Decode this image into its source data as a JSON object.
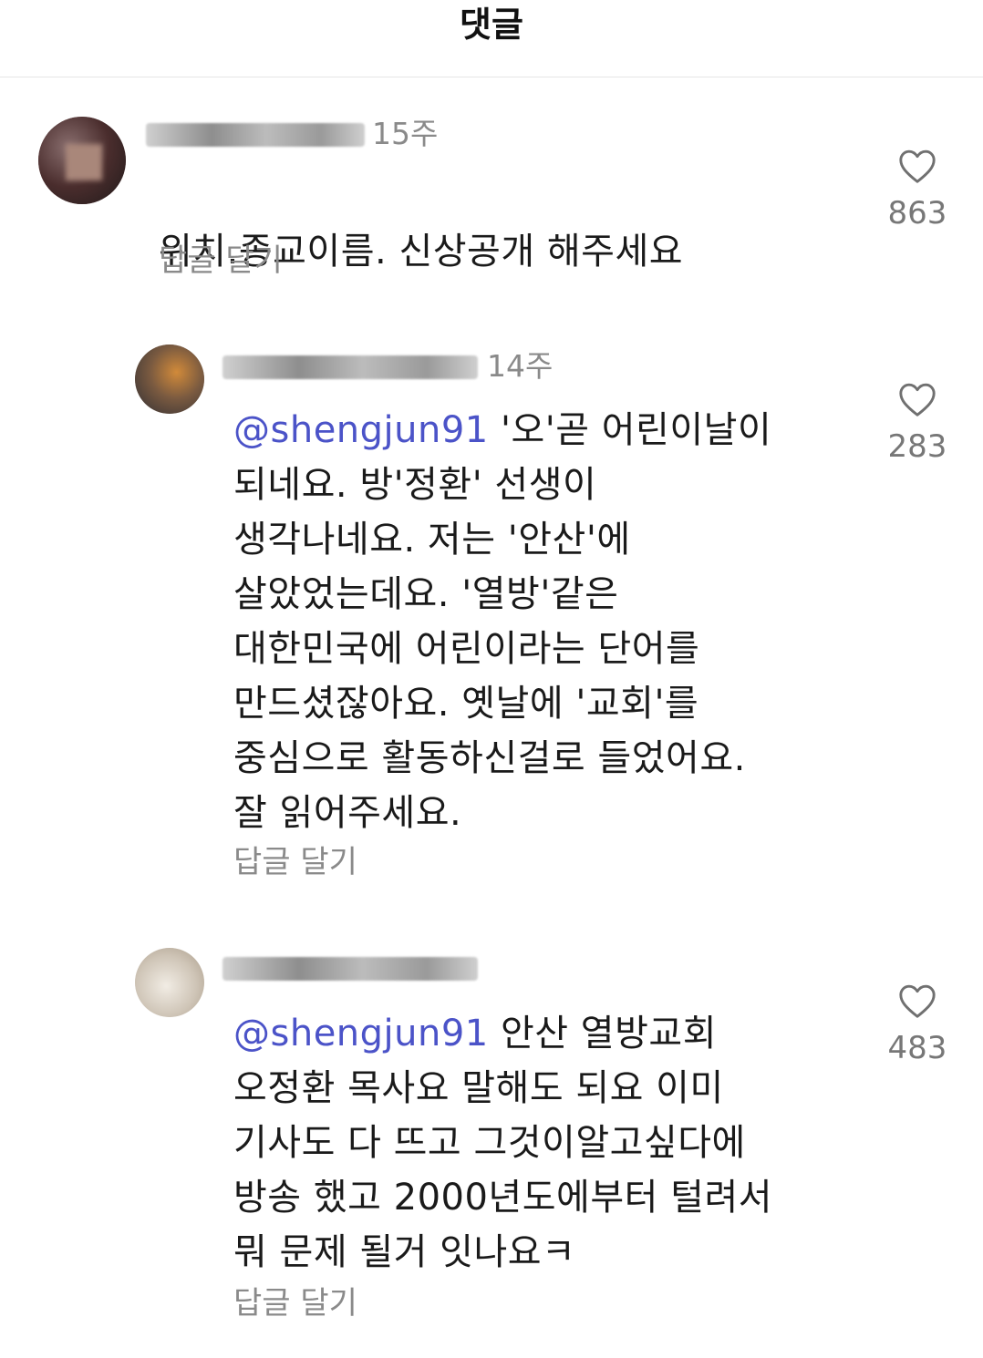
{
  "header": {
    "title": "댓글"
  },
  "comments": [
    {
      "time": "15주",
      "text_lines": [
        "위치.종교이름. 신상공개 해주세요"
      ],
      "mention": "",
      "reply_label": "답글 달기",
      "likes": "863"
    },
    {
      "time": "14주",
      "mention": "@shengjun91",
      "text_lines": [
        " '오'곧 어린이날이",
        "되네요. 방'정환' 선생이",
        "생각나네요. 저는 '안산'에",
        "살았었는데요. '열방'같은",
        "대한민국에 어린이라는 단어를",
        "만드셨잖아요. 옛날에 '교회'를",
        "중심으로 활동하신걸로 들었어요.",
        "잘 읽어주세요."
      ],
      "reply_label": "답글 달기",
      "likes": "283"
    },
    {
      "time": "",
      "mention": "@shengjun91",
      "text_lines": [
        " 안산 열방교회",
        "오정환 목사요 말해도 되요 이미",
        "기사도 다 뜨고 그것이알고싶다에",
        "방송 했고 2000년도에부터 털려서",
        "뭐 문제 될거 잇나요ㅋ"
      ],
      "reply_label": "답글 달기",
      "likes": "483"
    }
  ],
  "icons": {
    "like": "heart-outline-icon"
  },
  "colors": {
    "mention": "#4b53c8",
    "muted": "#8a8a8a"
  }
}
